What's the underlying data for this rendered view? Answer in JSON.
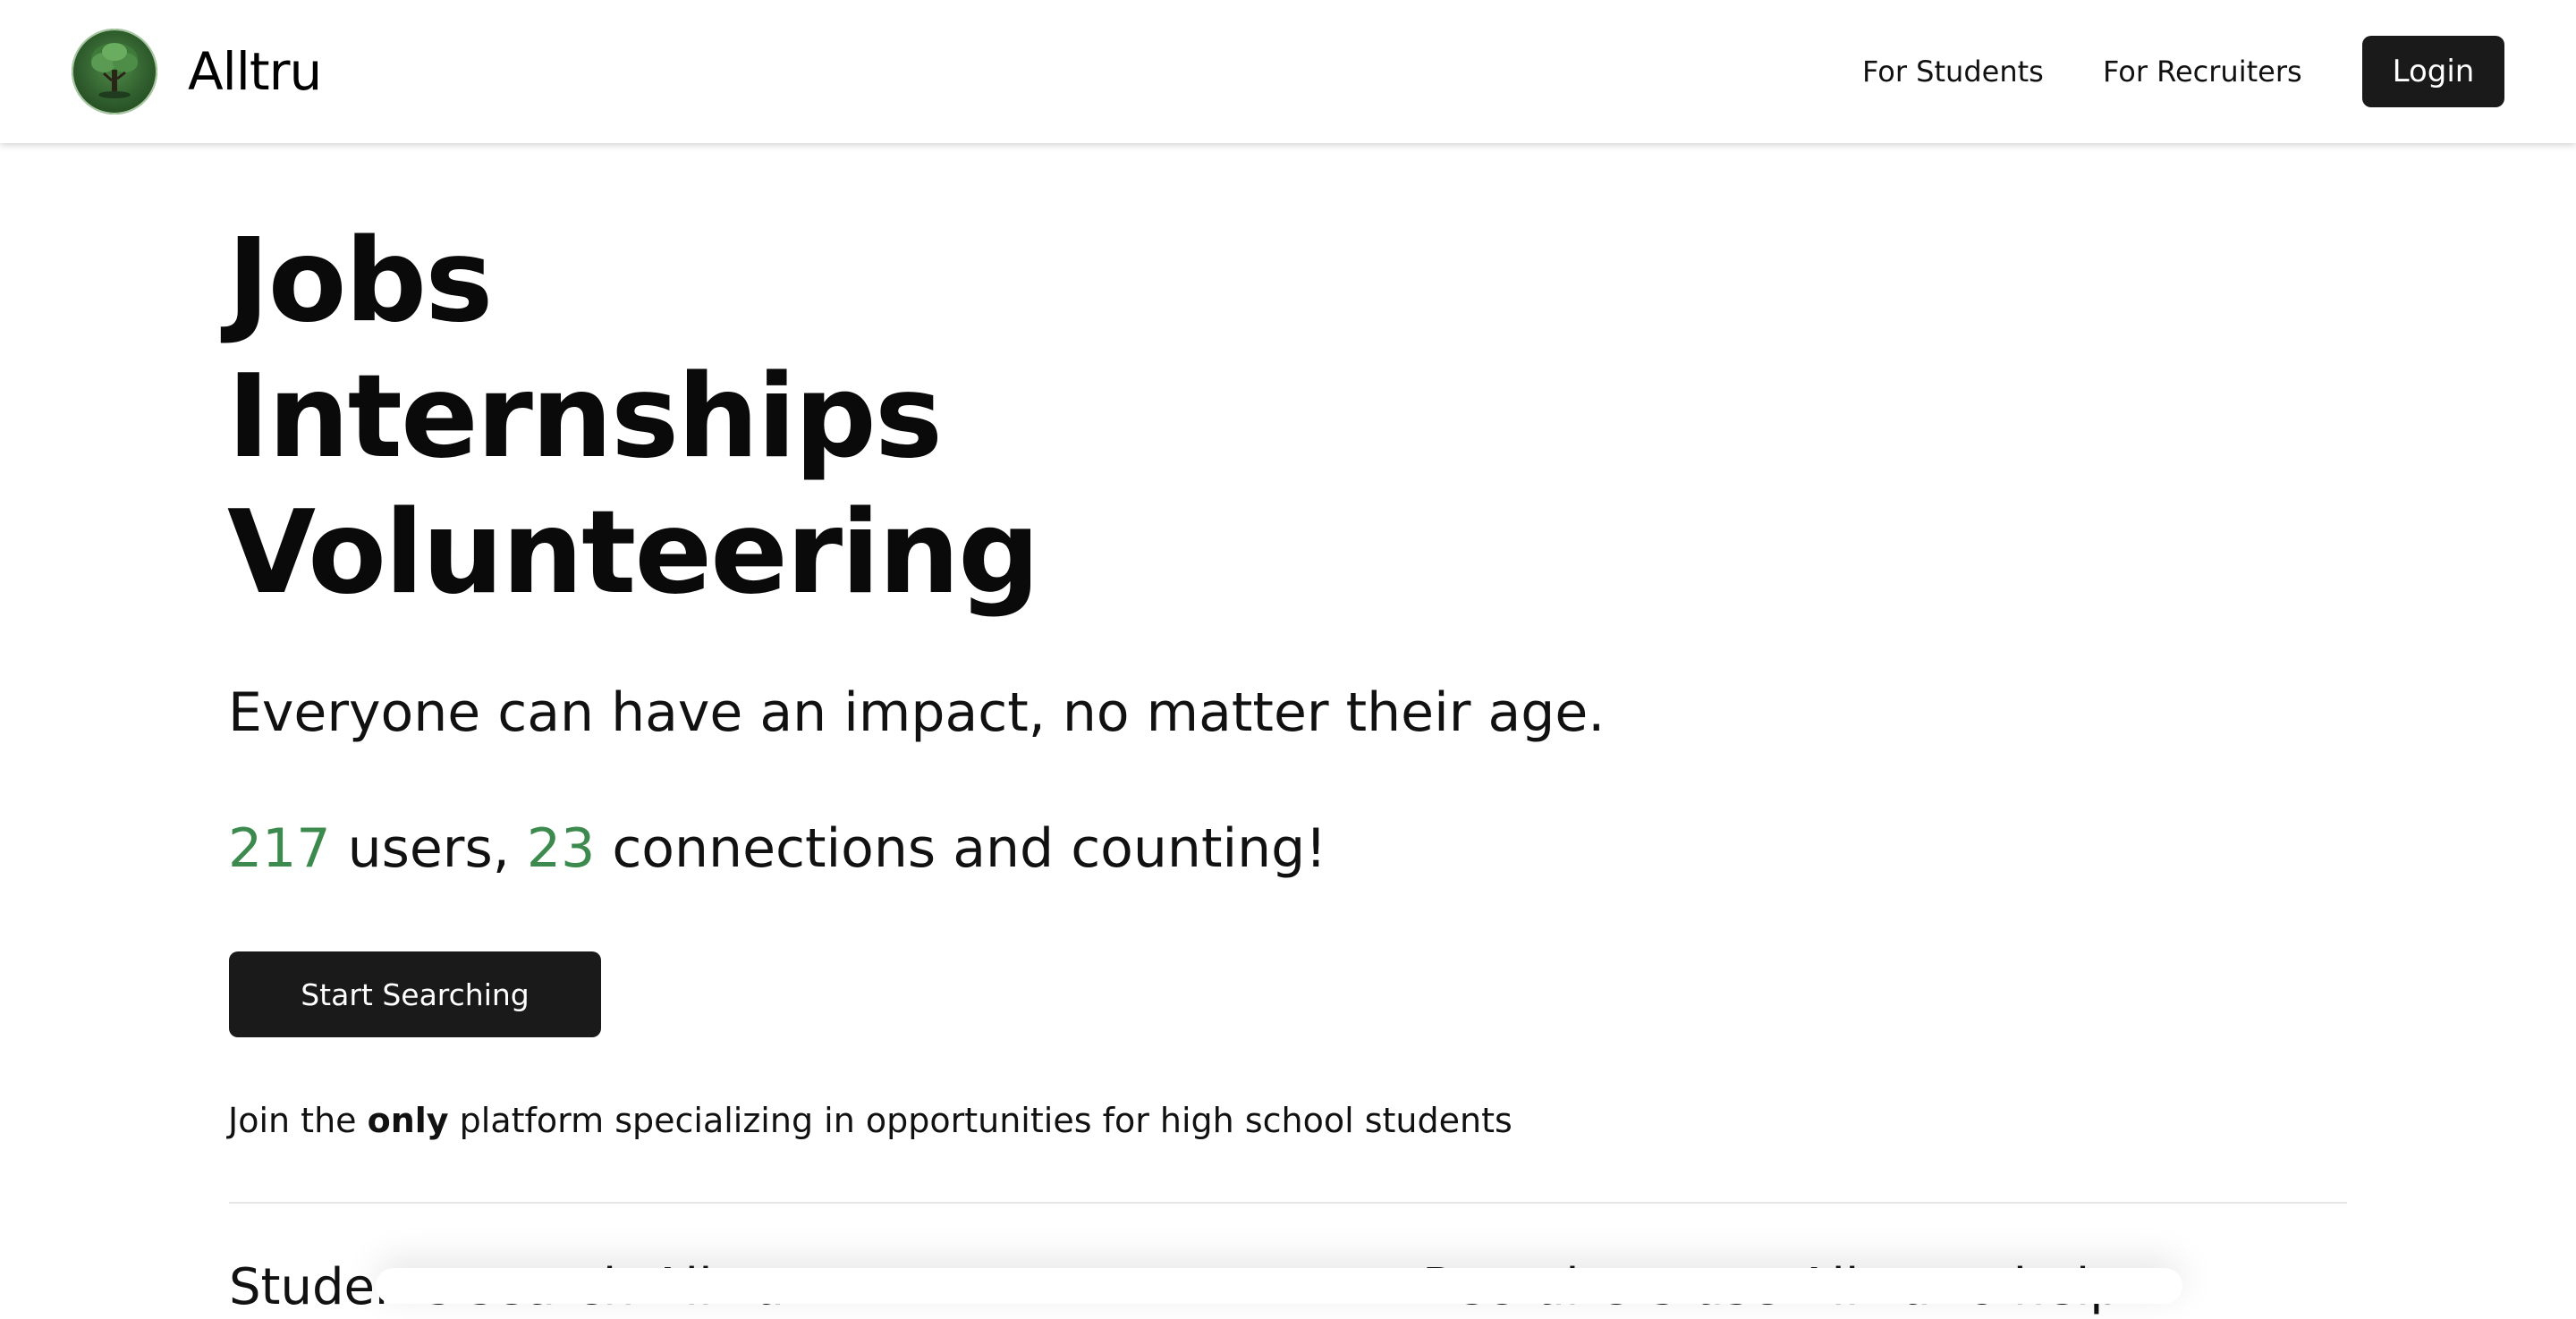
{
  "nav": {
    "brand_name": "Alltru",
    "logo_icon": "tree-icon",
    "links": [
      "For Students",
      "For Recruiters"
    ],
    "login_label": "Login"
  },
  "hero": {
    "lines": [
      "Jobs",
      "Internships",
      "Volunteering"
    ],
    "tagline": "Everyone can have an impact, no matter their age.",
    "stats": {
      "users_count": "217",
      "users_label": " users, ",
      "connections_count": "23",
      "connections_label": " connections and counting!"
    },
    "cta_label": "Start Searching",
    "join": {
      "prefix": "Join the ",
      "emphasis": "only",
      "suffix": " platform specializing in opportunities for high school students"
    }
  },
  "section_peek": {
    "left_heading": "Students search Alltru",
    "right_heading": "Recruiters use Alltru to help"
  },
  "colors": {
    "accent_green": "#3d8a4e",
    "button_dark": "#1a1a1a"
  }
}
